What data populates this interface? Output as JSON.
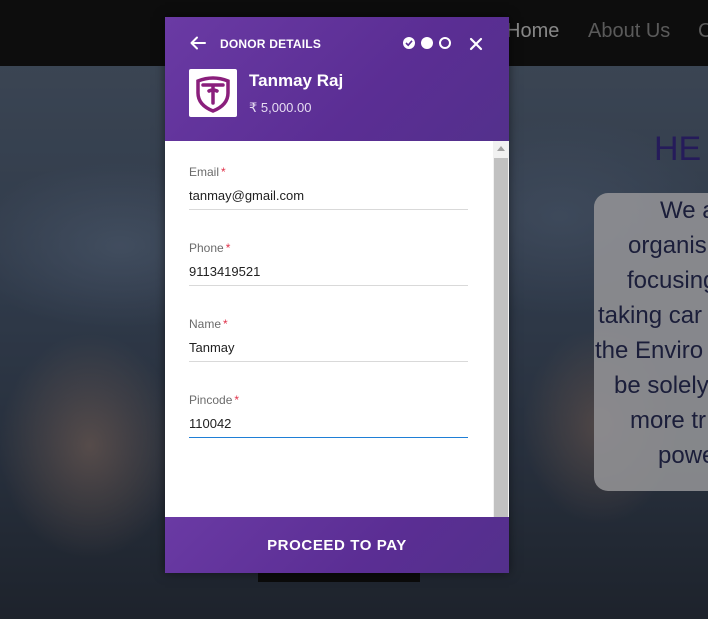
{
  "site": {
    "nav": {
      "home": "Home",
      "about": "About Us",
      "more": "C"
    },
    "hero_heading": "HE",
    "hero_lines": [
      "We a",
      "organis",
      "focusing",
      "taking car",
      "the Enviro",
      "be solely",
      "more tr",
      "powe"
    ]
  },
  "modal": {
    "header_title": "DONOR DETAILS",
    "back_icon": "arrow-left-icon",
    "close_icon": "close-icon",
    "steps": [
      "done",
      "active",
      "todo"
    ],
    "org_name": "Tanmay Raj",
    "amount": "₹ 5,000.00",
    "fields": [
      {
        "label": "Email",
        "required": "*",
        "value": "tanmay@gmail.com"
      },
      {
        "label": "Phone",
        "required": "*",
        "value": "9113419521"
      },
      {
        "label": "Name",
        "required": "*",
        "value": "Tanmay"
      },
      {
        "label": "Pincode",
        "required": "*",
        "value": "110042"
      }
    ],
    "pay_label": "PROCEED TO PAY"
  },
  "colors": {
    "brand_purple": "#5b2e94",
    "required_red": "#e0324a",
    "focus_blue": "#1f7fd6"
  }
}
